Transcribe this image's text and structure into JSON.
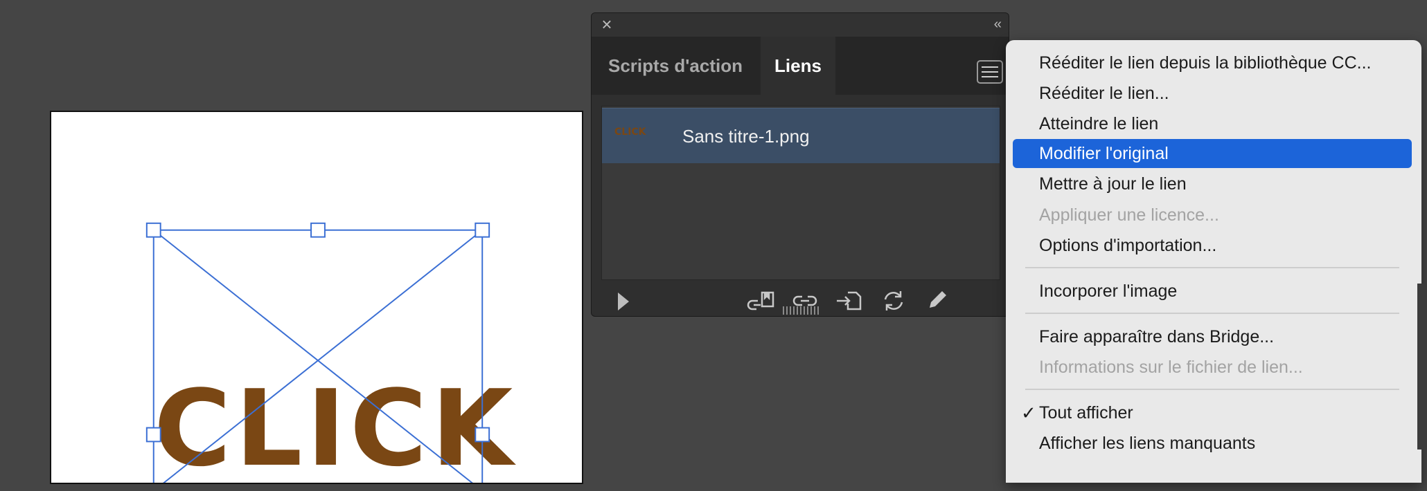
{
  "document": {
    "artwork_text": "CLICK",
    "artwork_color": "#7a4714",
    "frame_color": "#3b6fd4"
  },
  "panel": {
    "close_icon": "close-icon",
    "collapse_icon": "double-chevron-left-icon",
    "tabs": [
      {
        "label": "Scripts d'action",
        "active": false
      },
      {
        "label": "Liens",
        "active": true
      }
    ],
    "links": [
      {
        "thumb_text": "CLICK",
        "name": "Sans titre-1.png",
        "selected": true
      }
    ],
    "footer_icons": [
      "relink-cc-library-icon",
      "relink-icon",
      "goto-link-icon",
      "update-link-icon",
      "edit-original-icon"
    ]
  },
  "menu": {
    "items": [
      {
        "label": "Rééditer le lien depuis la bibliothèque CC...",
        "enabled": true
      },
      {
        "label": "Rééditer le lien...",
        "enabled": true
      },
      {
        "label": "Atteindre le lien",
        "enabled": true
      },
      {
        "label": "Modifier l'original",
        "enabled": true,
        "highlighted": true
      },
      {
        "label": "Mettre à jour le lien",
        "enabled": true
      },
      {
        "label": "Appliquer une licence...",
        "enabled": false
      },
      {
        "label": "Options d'importation...",
        "enabled": true
      },
      {
        "label": "Incorporer l'image",
        "enabled": true
      },
      {
        "label": "Faire apparaître dans Bridge...",
        "enabled": true
      },
      {
        "label": "Informations sur le fichier de lien...",
        "enabled": false
      },
      {
        "label": "Tout afficher",
        "enabled": true,
        "checked": true
      },
      {
        "label": "Afficher les liens manquants",
        "enabled": true
      }
    ],
    "check_glyph": "✓",
    "highlight_color": "#1c64d9"
  }
}
